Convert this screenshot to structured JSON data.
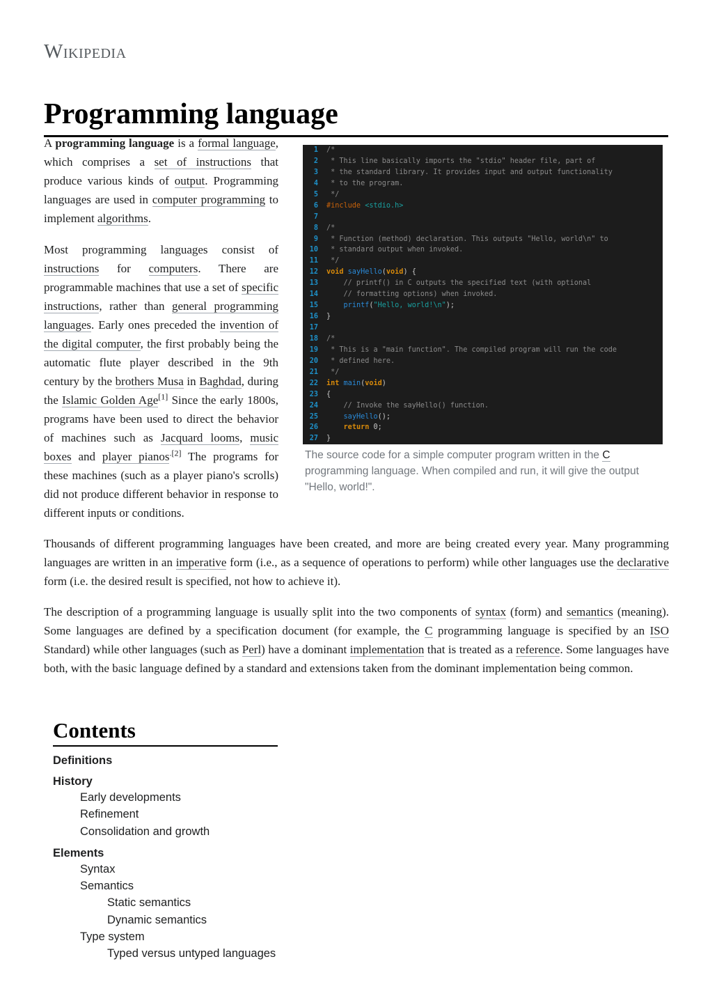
{
  "site": {
    "wordmark": "Wikipedia"
  },
  "article": {
    "title": "Programming language",
    "intro_p1": [
      {
        "t": "A "
      },
      {
        "t": "programming language",
        "b": true
      },
      {
        "t": " is a "
      },
      {
        "t": "formal language",
        "link": true
      },
      {
        "t": ", which comprises a "
      },
      {
        "t": "set of instructions",
        "link": true
      },
      {
        "t": " that produce various kinds of "
      },
      {
        "t": "output",
        "link": true
      },
      {
        "t": ". Programming languages are used in "
      },
      {
        "t": "computer programming",
        "link": true
      },
      {
        "t": " to implement "
      },
      {
        "t": "algorithms",
        "link": true
      },
      {
        "t": "."
      }
    ],
    "intro_p2": [
      {
        "t": "Most programming languages consist of "
      },
      {
        "t": "instructions",
        "link": true
      },
      {
        "t": " for "
      },
      {
        "t": "computers",
        "link": true
      },
      {
        "t": ". There are programmable machines that use a set of "
      },
      {
        "t": "specific instructions",
        "link": true
      },
      {
        "t": ", rather than "
      },
      {
        "t": "general programming languages",
        "link": true
      },
      {
        "t": ". Early ones preceded the "
      },
      {
        "t": "invention of the digital computer",
        "link": true
      },
      {
        "t": ", the first probably being the automatic flute player described in the 9th century by the "
      },
      {
        "t": "brothers Musa",
        "link": true
      },
      {
        "t": " in "
      },
      {
        "t": "Baghdad",
        "link": true
      },
      {
        "t": ", during the "
      },
      {
        "t": "Islamic Golden Age",
        "link": true
      },
      {
        "t": "[1]",
        "sup": true
      },
      {
        "t": " Since the early 1800s, programs have been used to direct the behavior of machines such as "
      },
      {
        "t": "Jacquard looms",
        "link": true
      },
      {
        "t": ", "
      },
      {
        "t": "music boxes",
        "link": true
      },
      {
        "t": " and "
      },
      {
        "t": "player pianos",
        "link": true
      },
      {
        "t": ".[2]",
        "sup": true
      },
      {
        "t": " The programs for these machines (such as a player piano's scrolls) did not produce different behavior in response to different inputs or conditions."
      }
    ],
    "p3": [
      {
        "t": "Thousands of different programming languages have been created, and more are being created every year. Many programming languages are written in an "
      },
      {
        "t": "imperative",
        "link": true
      },
      {
        "t": " form (i.e., as a sequence of operations to perform) while other languages use the "
      },
      {
        "t": "declarative",
        "link": true
      },
      {
        "t": " form (i.e. the desired result is specified, not how to achieve it)."
      }
    ],
    "p4": [
      {
        "t": "The description of a programming language is usually split into the two components of "
      },
      {
        "t": "syntax",
        "link": true
      },
      {
        "t": " (form) and "
      },
      {
        "t": "semantics",
        "link": true
      },
      {
        "t": " (meaning). Some languages are defined by a specification document (for example, the "
      },
      {
        "t": "C",
        "link": true
      },
      {
        "t": " programming language is specified by an "
      },
      {
        "t": "ISO",
        "link": true
      },
      {
        "t": " Standard) while other languages (such as "
      },
      {
        "t": "Perl",
        "link": true
      },
      {
        "t": ") have a dominant "
      },
      {
        "t": "implementation",
        "link": true
      },
      {
        "t": " that is treated as a "
      },
      {
        "t": "reference",
        "link": true
      },
      {
        "t": ". Some languages have both, with the basic language defined by a standard and extensions taken from the dominant implementation being common."
      }
    ]
  },
  "figure": {
    "code_lines": [
      [
        [
          "cm",
          "/*"
        ]
      ],
      [
        [
          "cm",
          " * This line basically imports the \"stdio\" header file, part of"
        ]
      ],
      [
        [
          "cm",
          " * the standard library. It provides input and output functionality"
        ]
      ],
      [
        [
          "cm",
          " * to the program."
        ]
      ],
      [
        [
          "cm",
          " */"
        ]
      ],
      [
        [
          "pre",
          "#include "
        ],
        [
          "str",
          "<stdio.h>"
        ]
      ],
      [],
      [
        [
          "cm",
          "/*"
        ]
      ],
      [
        [
          "cm",
          " * Function (method) declaration. This outputs \"Hello, world\\n\" to"
        ]
      ],
      [
        [
          "cm",
          " * standard output when invoked."
        ]
      ],
      [
        [
          "cm",
          " */"
        ]
      ],
      [
        [
          "kw",
          "void "
        ],
        [
          "fn",
          "sayHello"
        ],
        [
          "pl",
          "("
        ],
        [
          "kw",
          "void"
        ],
        [
          "pl",
          ") {"
        ]
      ],
      [
        [
          "cm",
          "    // printf() in C outputs the specified text (with optional"
        ]
      ],
      [
        [
          "cm",
          "    // formatting options) when invoked."
        ]
      ],
      [
        [
          "pl",
          "    "
        ],
        [
          "fn",
          "printf"
        ],
        [
          "pl",
          "("
        ],
        [
          "str",
          "\"Hello, world!\\n\""
        ],
        [
          "pl",
          ");"
        ]
      ],
      [
        [
          "pl",
          "}"
        ]
      ],
      [],
      [
        [
          "cm",
          "/*"
        ]
      ],
      [
        [
          "cm",
          " * This is a \"main function\". The compiled program will run the code"
        ]
      ],
      [
        [
          "cm",
          " * defined here."
        ]
      ],
      [
        [
          "cm",
          " */"
        ]
      ],
      [
        [
          "kw",
          "int "
        ],
        [
          "fn",
          "main"
        ],
        [
          "pl",
          "("
        ],
        [
          "kw",
          "void"
        ],
        [
          "pl",
          ")"
        ]
      ],
      [
        [
          "pl",
          "{"
        ]
      ],
      [
        [
          "cm",
          "    // Invoke the sayHello() function."
        ]
      ],
      [
        [
          "pl",
          "    "
        ],
        [
          "fn",
          "sayHello"
        ],
        [
          "pl",
          "();"
        ]
      ],
      [
        [
          "pl",
          "    "
        ],
        [
          "kw",
          "return "
        ],
        [
          "pl",
          "0;"
        ]
      ],
      [
        [
          "pl",
          "}"
        ]
      ]
    ],
    "caption": [
      {
        "t": "The source code for a simple computer program written in the "
      },
      {
        "t": "C",
        "link": true
      },
      {
        "t": " programming language. When compiled and run, it will give the output \"Hello, world!\"."
      }
    ]
  },
  "contents": {
    "heading": "Contents",
    "items": [
      {
        "label": "Definitions",
        "level": 1
      },
      {
        "label": "History",
        "level": 1
      },
      {
        "label": "Early developments",
        "level": 2
      },
      {
        "label": "Refinement",
        "level": 2
      },
      {
        "label": "Consolidation and growth",
        "level": 2
      },
      {
        "label": "Elements",
        "level": 1
      },
      {
        "label": "Syntax",
        "level": 2
      },
      {
        "label": "Semantics",
        "level": 2
      },
      {
        "label": "Static semantics",
        "level": 3
      },
      {
        "label": "Dynamic semantics",
        "level": 3
      },
      {
        "label": "Type system",
        "level": 2
      },
      {
        "label": "Typed versus untyped languages",
        "level": 3
      }
    ]
  }
}
